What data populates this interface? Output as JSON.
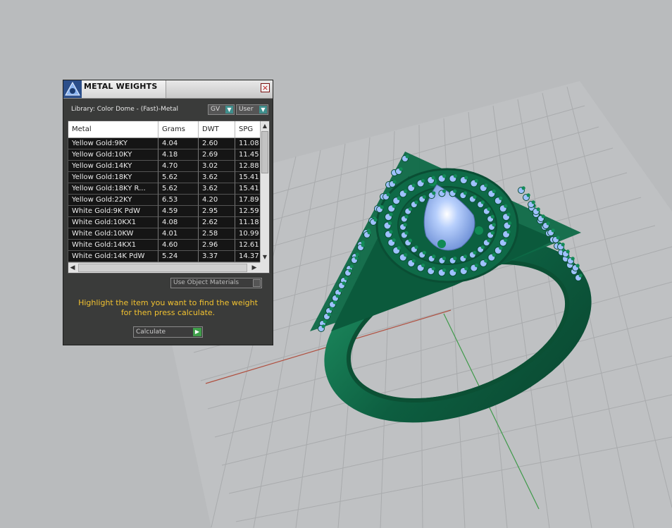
{
  "dialog": {
    "title": "METAL WEIGHTS",
    "close_glyph": "×",
    "library_label": "Library: Color Dome - (Fast)-Metal",
    "gv_dropdown": "GV",
    "user_dropdown": "User",
    "use_object_materials": "Use Object Materials",
    "hint_line1": "Highlight the item you want to find the weight",
    "hint_line2": "for then press calculate.",
    "calculate_label": "Calculate"
  },
  "table": {
    "columns": [
      "Metal",
      "Grams",
      "DWT",
      "SPG"
    ],
    "rows": [
      [
        "Yellow Gold:9KY",
        "4.04",
        "2.60",
        "11.08"
      ],
      [
        "Yellow Gold:10KY",
        "4.18",
        "2.69",
        "11.45"
      ],
      [
        "Yellow Gold:14KY",
        "4.70",
        "3.02",
        "12.88"
      ],
      [
        "Yellow Gold:18KY",
        "5.62",
        "3.62",
        "15.41"
      ],
      [
        "Yellow Gold:18KY R...",
        "5.62",
        "3.62",
        "15.41"
      ],
      [
        "Yellow Gold:22KY",
        "6.53",
        "4.20",
        "17.89"
      ],
      [
        "White Gold:9K PdW",
        "4.59",
        "2.95",
        "12.59"
      ],
      [
        "White Gold:10KX1",
        "4.08",
        "2.62",
        "11.18"
      ],
      [
        "White Gold:10KW",
        "4.01",
        "2.58",
        "10.99"
      ],
      [
        "White Gold:14KX1",
        "4.60",
        "2.96",
        "12.61"
      ],
      [
        "White Gold:14K PdW",
        "5.24",
        "3.37",
        "14.37"
      ]
    ]
  },
  "icons": {
    "close": "close-icon",
    "dropdown": "chevron-down-icon",
    "go": "play-arrow-icon"
  },
  "colors": {
    "viewport_bg": "#b9bbbd",
    "ring_green": "#0f6a48",
    "stone_blue": "#9fc1ff",
    "hint_text": "#f2c230",
    "panel_bg": "#3a3b3a"
  }
}
